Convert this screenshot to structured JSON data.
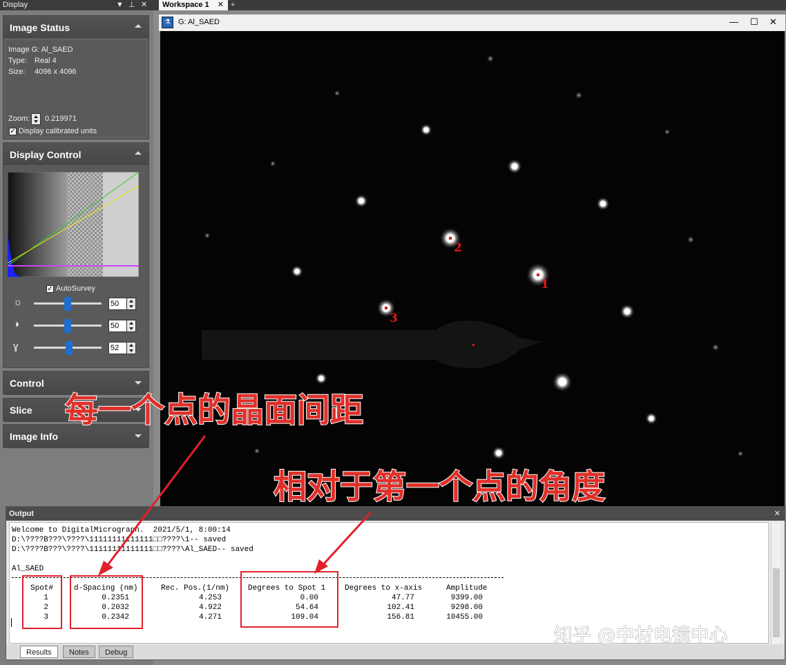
{
  "left_panel": {
    "title": "Display",
    "title_icons": [
      "▼",
      "⊥",
      "✕"
    ],
    "image_status": {
      "header": "Image Status",
      "image_line": "Image G: Al_SAED",
      "type_label": "Type:",
      "type_value": "Real 4",
      "size_label": "Size:",
      "size_value": "4096 x 4096",
      "zoom_label": "Zoom:",
      "zoom_value": "0.219971",
      "calibrated_label": "Display calibrated units",
      "calibrated_checked": true
    },
    "display_control": {
      "header": "Display Control",
      "autosurvey_label": "AutoSurvey",
      "autosurvey_checked": true,
      "sliders": [
        {
          "icon": "brightness-icon",
          "glyph": "☼",
          "value": "50",
          "level": 0.5
        },
        {
          "icon": "contrast-icon",
          "glyph": "◑",
          "value": "50",
          "level": 0.5
        },
        {
          "icon": "gamma-icon",
          "glyph": "ɣ",
          "value": "52",
          "level": 0.52
        }
      ]
    },
    "collapsed_sections": [
      "Control",
      "Slice",
      "Image Info"
    ]
  },
  "workspace": {
    "tab_label": "Workspace 1",
    "tab_close": "✕",
    "tab_add": "+",
    "image_window_title": "G: Al_SAED",
    "window_controls": [
      "—",
      "☐",
      "✕"
    ]
  },
  "spot_labels": [
    "1",
    "2",
    "3"
  ],
  "output": {
    "title": "Output",
    "close": "✕",
    "lines": [
      "Welcome to DigitalMicrograph.  2021/5/1, 8:00:14",
      "D:\\????B???\\????\\11111111111111□□????\\1-- saved",
      "D:\\????B???\\????\\11111111111111□□????\\Al_SAED-- saved",
      "",
      "Al_SAED"
    ],
    "table": {
      "headers": [
        "Spot#",
        "d-Spacing (nm)",
        "Rec. Pos.(1/nm)",
        "Degrees to Spot 1",
        "Degrees to x-axis",
        "Amplitude"
      ],
      "rows": [
        [
          "1",
          "0.2351",
          "4.253",
          "0.00",
          "47.77",
          "9399.00"
        ],
        [
          "2",
          "0.2032",
          "4.922",
          "54.64",
          "102.41",
          "9298.00"
        ],
        [
          "3",
          "0.2342",
          "4.271",
          "109.04",
          "156.81",
          "10455.00"
        ]
      ]
    },
    "tabs": [
      "Results",
      "Notes",
      "Debug"
    ]
  },
  "annotations": {
    "d_spacing_note": "每一个点的晶面间距",
    "angle_note": "相对于第一个点的角度"
  },
  "watermark": "知乎 @中材电镜中心",
  "colors": {
    "annotation_red": "#e0302a",
    "slider_thumb": "#1e6fd0",
    "spot_marker": "#e01818"
  }
}
